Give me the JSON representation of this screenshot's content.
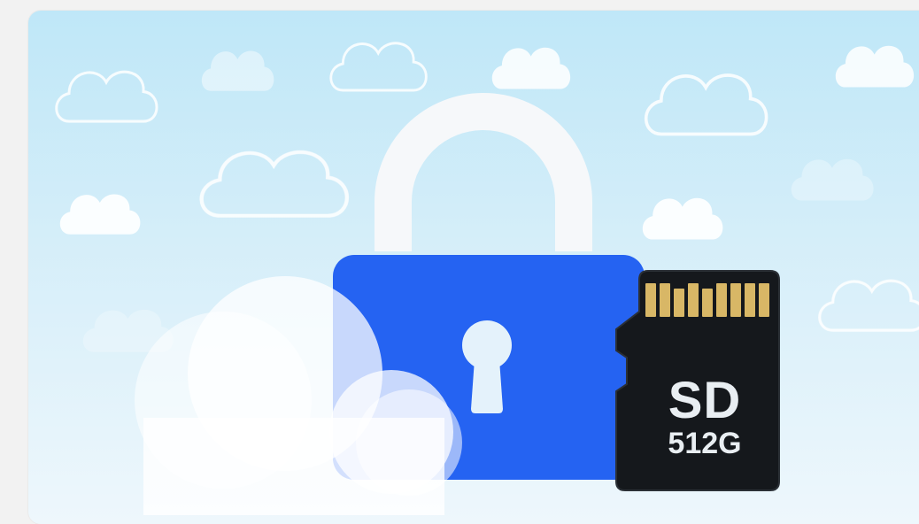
{
  "illustration": {
    "subject": "lock-with-sd-card",
    "sd_card": {
      "label": "SD",
      "capacity": "512G"
    },
    "colors": {
      "sky_top": "#bfe7f8",
      "sky_bottom": "#eef7fc",
      "lock_body": "#2563f2",
      "lock_shackle": "#f6f8fa",
      "keyhole": "#e4f2fb",
      "sd_card_body": "#15181c",
      "sd_card_contacts": "#d8b766",
      "sd_text": "#e9eef2"
    },
    "icons": [
      "cloud-icon",
      "padlock-icon",
      "keyhole-icon",
      "sd-card-icon"
    ]
  }
}
